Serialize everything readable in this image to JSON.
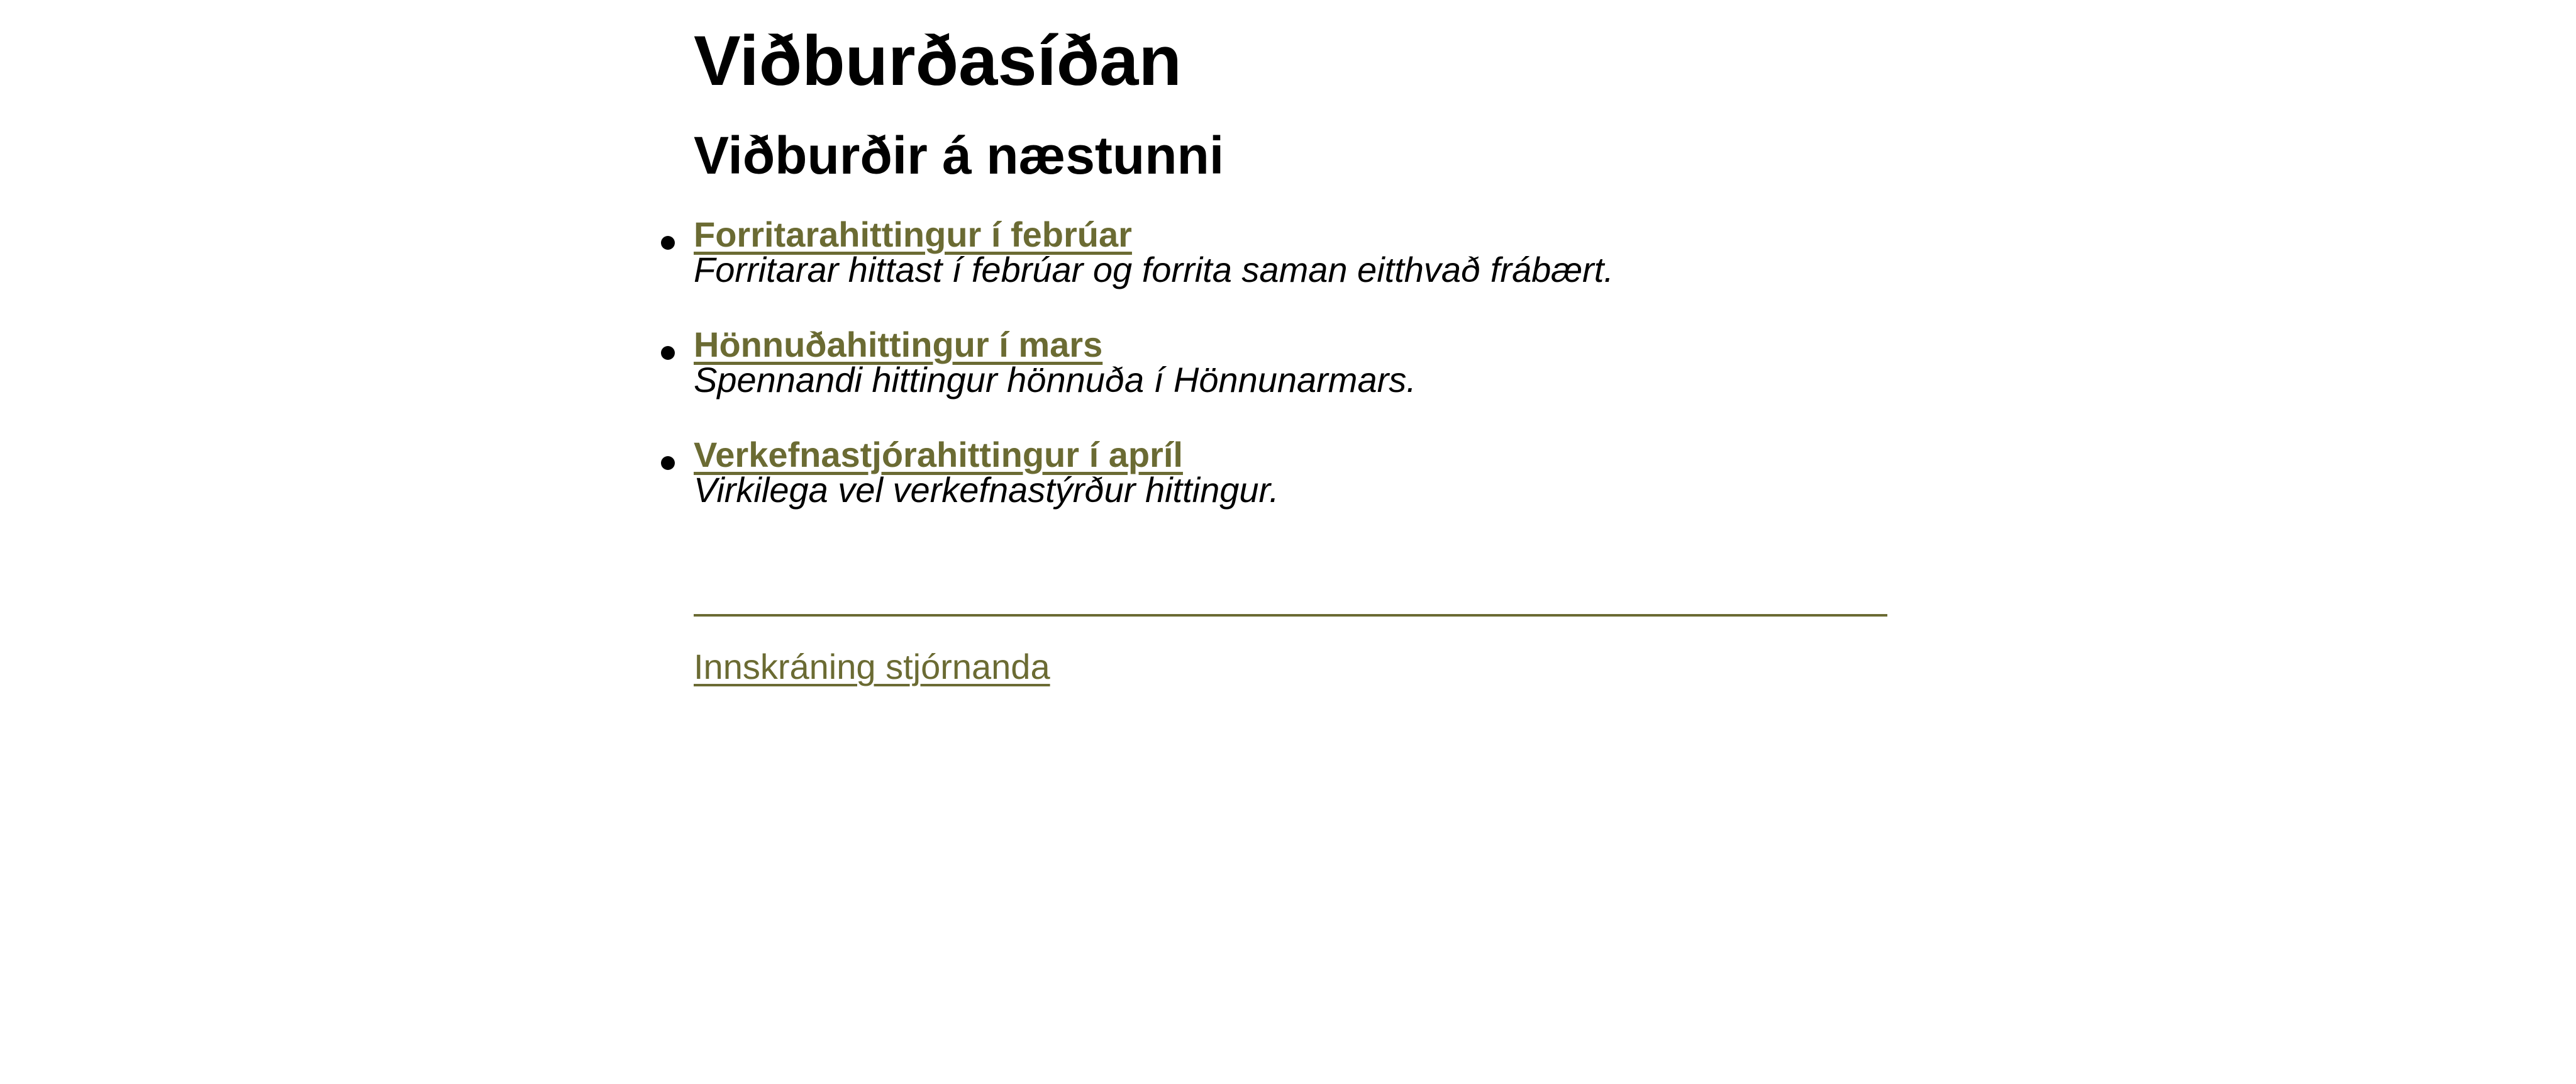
{
  "page": {
    "title": "Viðburðasíðan",
    "subtitle": "Viðburðir á næstunni"
  },
  "events": [
    {
      "title": "Forritarahittingur í febrúar",
      "description": "Forritarar hittast í febrúar og forrita saman eitthvað frábært."
    },
    {
      "title": "Hönnuðahittingur í mars",
      "description": "Spennandi hittingur hönnuða í Hönnunarmars."
    },
    {
      "title": "Verkefnastjórahittingur í apríl",
      "description": "Virkilega vel verkefnastýrður hittingur."
    }
  ],
  "footer": {
    "admin_login": "Innskráning stjórnanda"
  },
  "colors": {
    "link": "#6b6b33",
    "text": "#000000",
    "background": "#ffffff"
  }
}
